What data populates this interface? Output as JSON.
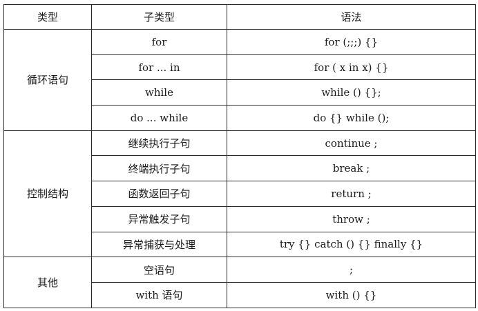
{
  "table": {
    "headers": {
      "type": "类型",
      "subtype": "子类型",
      "syntax": "语法"
    },
    "groups": [
      {
        "name": "循环语句",
        "rows": [
          {
            "subtype": "for",
            "syntax": "for (;;;) {}"
          },
          {
            "subtype": "for ... in",
            "syntax": "for ( x in x) {}"
          },
          {
            "subtype": "while",
            "syntax": "while () {};"
          },
          {
            "subtype": "do ... while",
            "syntax": "do {} while ();"
          }
        ]
      },
      {
        "name": "控制结构",
        "rows": [
          {
            "subtype": "继续执行子句",
            "syntax": "continue ;"
          },
          {
            "subtype": "终端执行子句",
            "syntax": "break ;"
          },
          {
            "subtype": "函数返回子句",
            "syntax": "return ;"
          },
          {
            "subtype": "异常触发子句",
            "syntax": "throw ;"
          },
          {
            "subtype": "异常捕获与处理",
            "syntax": "try {} catch () {} finally {}"
          }
        ]
      },
      {
        "name": "其他",
        "rows": [
          {
            "subtype": "空语句",
            "syntax": ";"
          },
          {
            "subtype": "with 语句",
            "syntax": "with () {}"
          }
        ]
      }
    ]
  }
}
